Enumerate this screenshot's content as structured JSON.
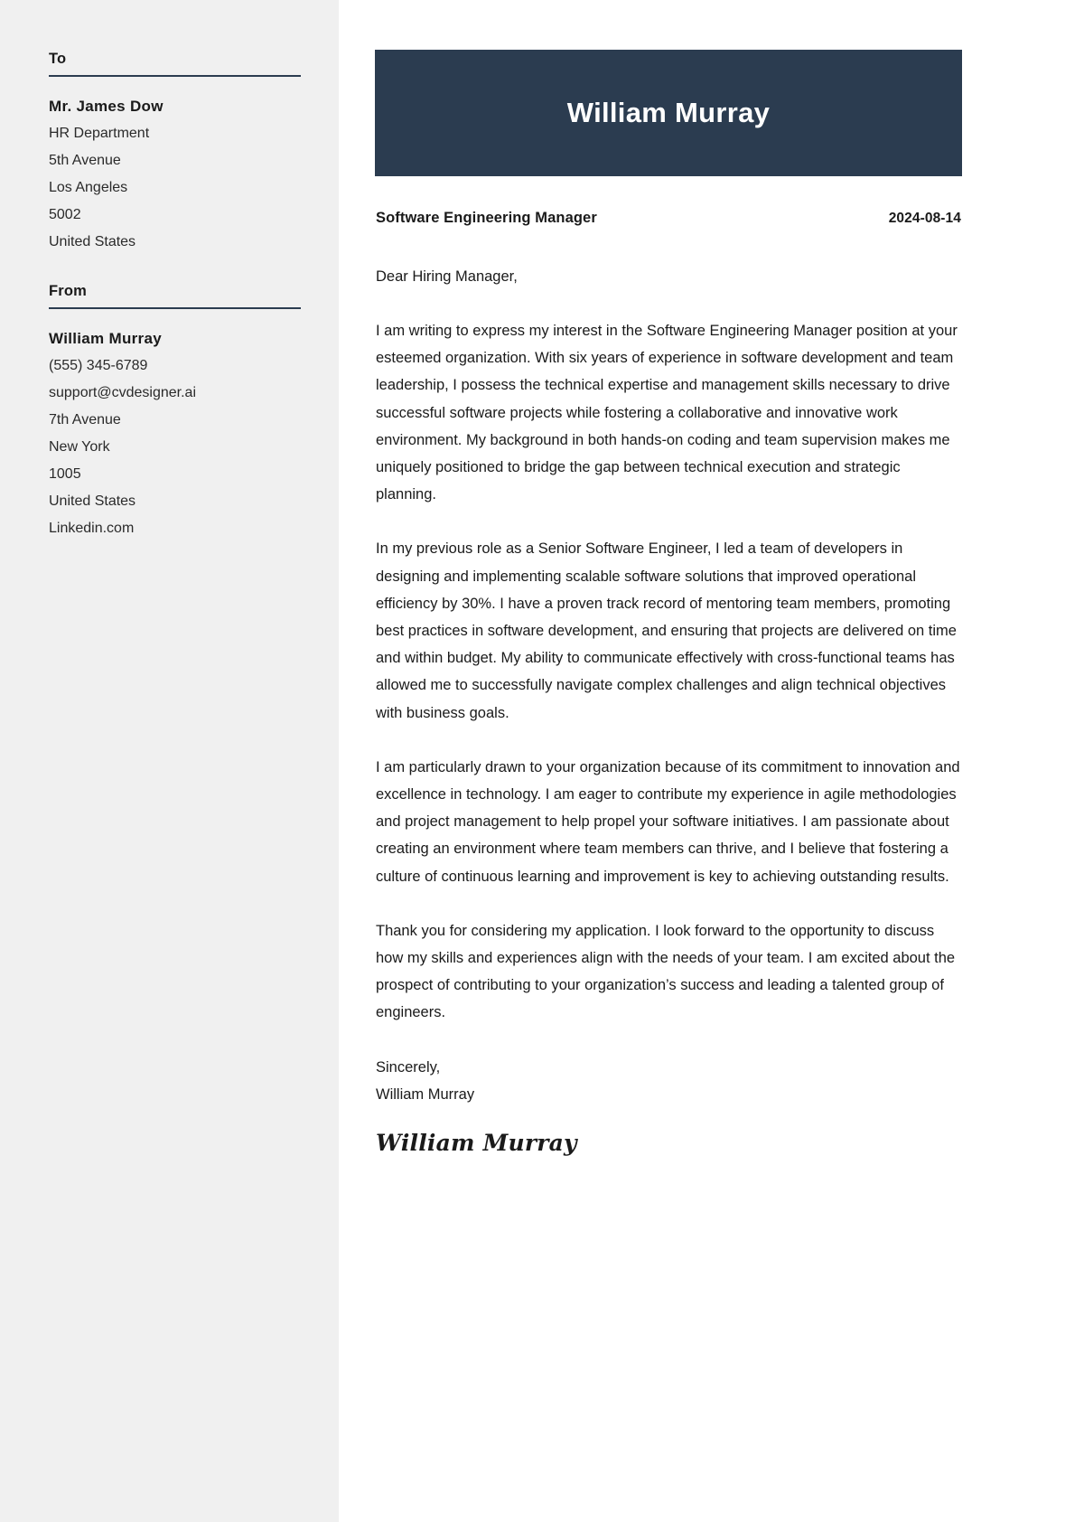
{
  "theme": {
    "accent": "#2b3c50",
    "sidebar_bg": "#f0f0f0",
    "page_bg": "#ffffff",
    "text": "#1a1a1a"
  },
  "sidebar": {
    "to": {
      "heading": "To",
      "name": "Mr. James Dow",
      "lines": [
        "HR Department",
        "5th Avenue",
        "Los Angeles",
        "5002",
        "United States"
      ]
    },
    "from": {
      "heading": "From",
      "name": "William Murray",
      "lines": [
        "(555) 345-6789",
        "support@cvdesigner.ai",
        "7th Avenue",
        "New York",
        "1005",
        "United States",
        "Linkedin.com"
      ]
    }
  },
  "header": {
    "name": "William Murray"
  },
  "letter": {
    "job_title": "Software Engineering Manager",
    "date": "2024-08-14",
    "salutation": "Dear Hiring Manager,",
    "paragraphs": [
      "I am writing to express my interest in the Software Engineering Manager position at your esteemed organization. With six years of experience in software development and team leadership, I possess the technical expertise and management skills necessary to drive successful software projects while fostering a collaborative and innovative work environment. My background in both hands-on coding and team supervision makes me uniquely positioned to bridge the gap between technical execution and strategic planning.",
      "In my previous role as a Senior Software Engineer, I led a team of developers in designing and implementing scalable software solutions that improved operational efficiency by 30%. I have a proven track record of mentoring team members, promoting best practices in software development, and ensuring that projects are delivered on time and within budget. My ability to communicate effectively with cross-functional teams has allowed me to successfully navigate complex challenges and align technical objectives with business goals.",
      "I am particularly drawn to your organization because of its commitment to innovation and excellence in technology. I am eager to contribute my experience in agile methodologies and project management to help propel your software initiatives. I am passionate about creating an environment where team members can thrive, and I believe that fostering a culture of continuous learning and improvement is key to achieving outstanding results.",
      "Thank you for considering my application. I look forward to the opportunity to discuss how my skills and experiences align with the needs of your team. I am excited about the prospect of contributing to your organization’s success and leading a talented group of engineers."
    ],
    "closing_word": "Sincerely,",
    "closing_name": "William Murray",
    "signature": "William Murray"
  }
}
